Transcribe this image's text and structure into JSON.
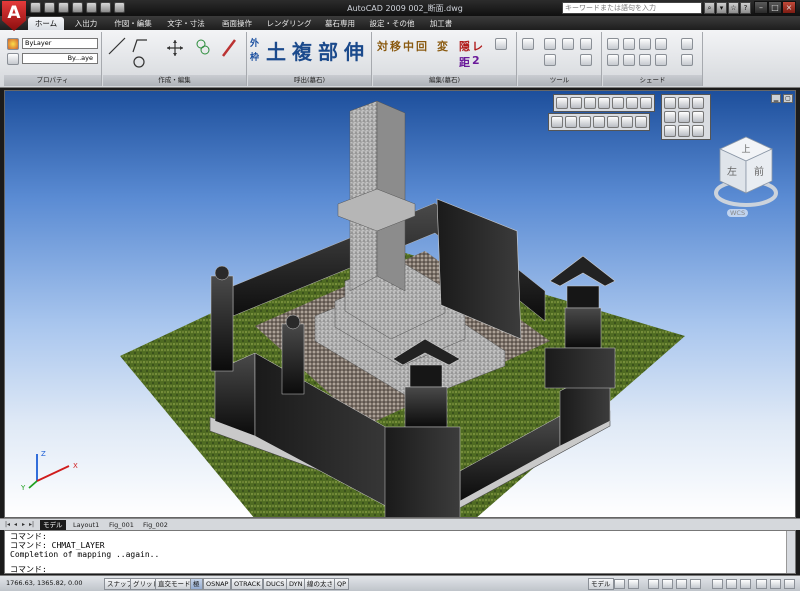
{
  "app": {
    "logo_letter": "A",
    "window_title": "AutoCAD 2009 002_断面.dwg",
    "search_placeholder": "キーワードまたは語句を入力"
  },
  "window_controls": {
    "minimize": "–",
    "maximize": "□",
    "close": "×"
  },
  "ribbon": {
    "tabs": [
      {
        "label": "ホーム",
        "active": true
      },
      {
        "label": "入出力"
      },
      {
        "label": "作図・編集"
      },
      {
        "label": "文字・寸法"
      },
      {
        "label": "画面操作"
      },
      {
        "label": "レンダリング"
      },
      {
        "label": "墓石専用"
      },
      {
        "label": "設定・その他"
      },
      {
        "label": "加工書"
      }
    ],
    "panels": {
      "properties": {
        "label": "プロパティ",
        "layer_combo": "ByLayer",
        "linetype_combo": "By...aye"
      },
      "draw": {
        "label": "作成・編集"
      },
      "call": {
        "label": "呼出(墓石)",
        "kanji": [
          "土",
          "複",
          "部",
          "伸"
        ],
        "small_top": "外",
        "small_bottom": "枠"
      },
      "edit": {
        "label": "編集(墓石)",
        "kanji_top": [
          "対",
          "移",
          "中",
          "回"
        ],
        "kanji_mid": "変",
        "kanji_right_top": "隠",
        "kanji_right_top2": "レ",
        "kanji_right_bottom": "距",
        "kanji_right_bottom2": "2"
      },
      "tools": {
        "label": "ツール"
      },
      "shade": {
        "label": "シェード"
      }
    }
  },
  "viewport": {
    "viewcube": {
      "top": "上",
      "front": "前",
      "left": "左",
      "wcs": "WCS"
    },
    "ucs": {
      "x": "X",
      "y": "Y",
      "z": "Z"
    }
  },
  "layout_tabs": [
    {
      "label": "モデル",
      "active": true
    },
    {
      "label": "Layout1"
    },
    {
      "label": "Fig_001"
    },
    {
      "label": "Fig_002"
    }
  ],
  "command": {
    "lines": [
      "コマンド:",
      "コマンド: CHMAT_LAYER",
      "Completion of mapping ..again..",
      "",
      "コマンド:"
    ]
  },
  "statusbar": {
    "coords": "1766.63, 1365.82, 0.00",
    "toggles": [
      {
        "label": "スナップ"
      },
      {
        "label": "グリッド"
      },
      {
        "label": "直交モード"
      },
      {
        "label": "極",
        "on": true
      },
      {
        "label": "OSNAP"
      },
      {
        "label": "OTRACK"
      },
      {
        "label": "DUCS"
      },
      {
        "label": "DYN"
      },
      {
        "label": "線の太さ"
      },
      {
        "label": "QP"
      }
    ],
    "model_label": "モデル"
  }
}
